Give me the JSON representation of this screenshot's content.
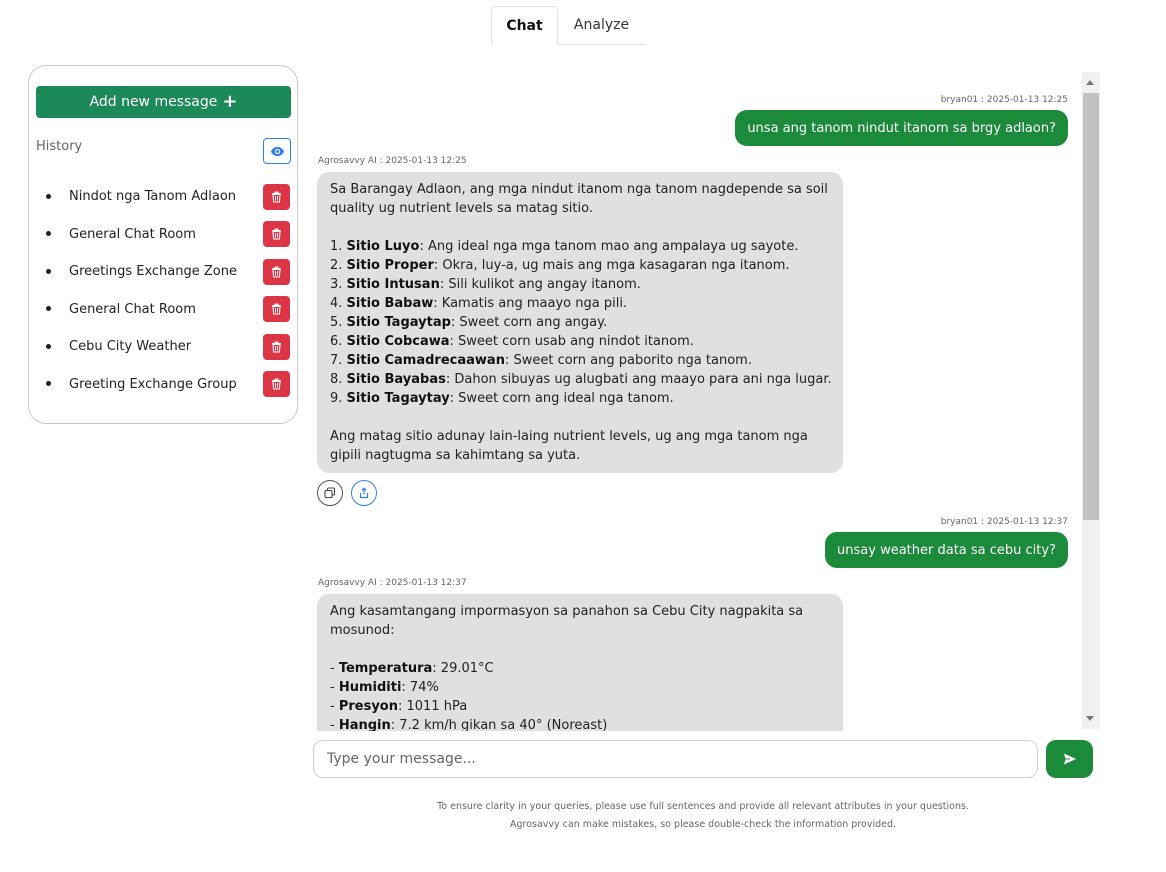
{
  "tabs": [
    {
      "label": "Chat",
      "active": true
    },
    {
      "label": "Analyze",
      "active": false
    }
  ],
  "sidebar": {
    "add_button_label": "Add new message",
    "add_button_icon": "plus-icon",
    "history_label": "History",
    "toggle_icon": "eye-icon",
    "items": [
      {
        "label": "Nindot nga Tanom Adlaon"
      },
      {
        "label": "General Chat Room"
      },
      {
        "label": "Greetings Exchange Zone"
      },
      {
        "label": "General Chat Room"
      },
      {
        "label": "Cebu City Weather"
      },
      {
        "label": "Greeting Exchange Group"
      }
    ],
    "delete_icon": "trash-icon"
  },
  "chat": {
    "messages": [
      {
        "role": "user",
        "meta": "bryan01 : 2025-01-13 12:25",
        "text": "unsa ang tanom nindut itanom sa brgy adlaon?"
      },
      {
        "role": "ai",
        "meta": "Agrosavvy AI : 2025-01-13 12:25",
        "lines": [
          {
            "pre": "",
            "bold": "",
            "text": "Sa Barangay Adlaon, ang mga nindut itanom nga tanom nagdepende sa soil quality ug nutrient levels sa matag sitio."
          },
          {
            "pre": "",
            "bold": "",
            "text": ""
          },
          {
            "pre": "1. ",
            "bold": "Sitio Luyo",
            "text": ": Ang ideal nga mga tanom mao ang ampalaya ug sayote."
          },
          {
            "pre": "2. ",
            "bold": "Sitio Proper",
            "text": ": Okra, luy-a, ug mais ang mga kasagaran nga itanom."
          },
          {
            "pre": "3. ",
            "bold": "Sitio Intusan",
            "text": ": Sili kulikot ang angay itanom."
          },
          {
            "pre": "4. ",
            "bold": "Sitio Babaw",
            "text": ": Kamatis ang maayo nga pili."
          },
          {
            "pre": "5. ",
            "bold": "Sitio Tagaytap",
            "text": ": Sweet corn ang angay."
          },
          {
            "pre": "6. ",
            "bold": "Sitio Cobcawa",
            "text": ": Sweet corn usab ang nindot itanom."
          },
          {
            "pre": "7. ",
            "bold": "Sitio Camadrecaawan",
            "text": ": Sweet corn ang paborito nga tanom."
          },
          {
            "pre": "8. ",
            "bold": "Sitio Bayabas",
            "text": ": Dahon sibuyas ug alugbati ang maayo para ani nga lugar."
          },
          {
            "pre": "9. ",
            "bold": "Sitio Tagaytay",
            "text": ": Sweet corn ang ideal nga tanom."
          },
          {
            "pre": "",
            "bold": "",
            "text": ""
          },
          {
            "pre": "",
            "bold": "",
            "text": "Ang matag sitio adunay lain-laing nutrient levels, ug ang mga tanom nga gipili nagtugma sa kahimtang sa yuta."
          }
        ],
        "actions": [
          "copy-icon",
          "share-icon"
        ]
      },
      {
        "role": "user",
        "meta": "bryan01 : 2025-01-13 12:37",
        "text": "unsay weather data sa cebu city?"
      },
      {
        "role": "ai",
        "meta": "Agrosavvy AI : 2025-01-13 12:37",
        "lines": [
          {
            "pre": "",
            "bold": "",
            "text": "Ang kasamtangang impormasyon sa panahon sa Cebu City nagpakita sa mosunod:"
          },
          {
            "pre": "",
            "bold": "",
            "text": ""
          },
          {
            "pre": "- ",
            "bold": "Temperatura",
            "text": ": 29.01°C"
          },
          {
            "pre": "- ",
            "bold": "Humiditi",
            "text": ": 74%"
          },
          {
            "pre": "- ",
            "bold": "Presyon",
            "text": ": 1011 hPa"
          },
          {
            "pre": "- ",
            "bold": "Hangin",
            "text": ": 7.2 km/h gikan sa 40° (Noreast)"
          }
        ]
      }
    ]
  },
  "input": {
    "placeholder": "Type your message...",
    "value": "",
    "send_icon": "send-icon"
  },
  "footer": {
    "line1": "To ensure clarity in your queries, please use full sentences and provide all relevant attributes in your questions.",
    "line2": "Agrosavvy can make mistakes, so please double-check the information provided."
  },
  "colors": {
    "primary_green": "#1b8a58",
    "bubble_green": "#1b8a3a",
    "danger_red": "#dc3545",
    "accent_blue": "#2f80ed",
    "ai_bubble_gray": "#e0e0e0"
  }
}
